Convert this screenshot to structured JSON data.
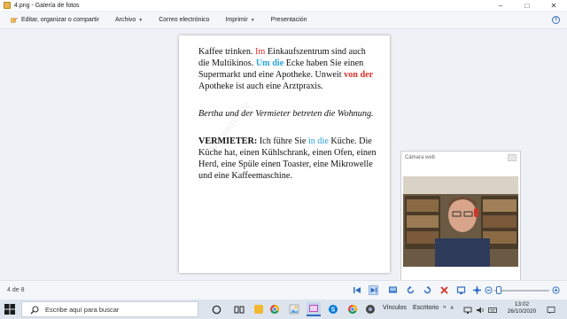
{
  "window": {
    "title": "4.png - Galería de fotos",
    "controls": {
      "minimize": "–",
      "maximize": "□",
      "close": "✕"
    }
  },
  "menubar": {
    "items": [
      {
        "label": "Editar, organizar o compartir",
        "icon": "edit-organize-icon"
      },
      {
        "label": "Archivo",
        "dropdown": true
      },
      {
        "label": "Correo electrónico"
      },
      {
        "label": "Imprimir",
        "dropdown": true
      },
      {
        "label": "Presentación"
      }
    ],
    "help": "?"
  },
  "document": {
    "p1": {
      "s1": "Kaffee trinken. ",
      "s2": "Im",
      "s3": " Einkaufszentrum sind auch die Multikinos. ",
      "s4": "Um die",
      "s5": " Ecke haben Sie einen Supermarkt und eine Apotheke. Unweit ",
      "s6": "von der",
      "s7": " Apotheke ist auch eine Arztpraxis."
    },
    "p2": "Bertha und der Vermieter betreten die Wohnung.",
    "p3": {
      "speaker": "VERMIETER:",
      "s1": " Ich führe Sie ",
      "s2": "in die",
      "s3": " Küche. Die Küche hat, einen Kühlschrank, einen Ofen, einen Herd, eine Spüle einen Toaster, eine Mikrowelle und eine Kaffeemaschine."
    },
    "watermark": "a  .  alogiemdme"
  },
  "webcam": {
    "title": "Cámara web"
  },
  "statusbar": {
    "page_count": "4 de 8"
  },
  "taskbar": {
    "search_placeholder": "Escribe aquí para buscar",
    "tray": {
      "links": "Vínculos",
      "desktop": "Escritorio"
    },
    "time": "13:02",
    "date": "26/10/2020"
  },
  "colors": {
    "accent": "#2b6cc4",
    "red_text": "#d9322b",
    "blue_text": "#2aa2d6"
  }
}
